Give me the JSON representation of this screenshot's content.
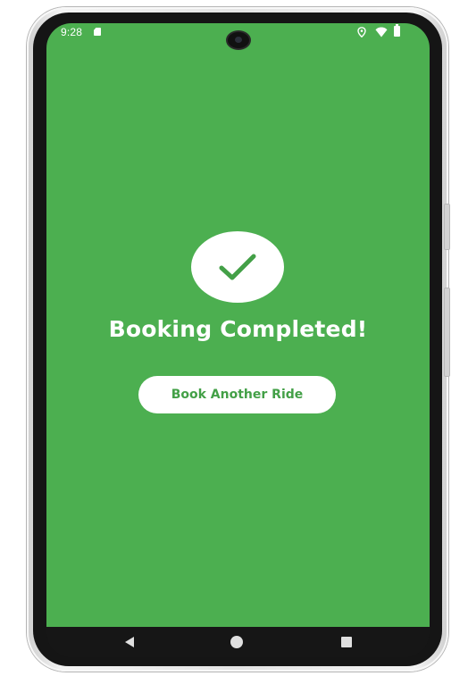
{
  "status_bar": {
    "time": "9:28",
    "icons": [
      "sim-card-icon",
      "location-icon",
      "wifi-icon",
      "battery-icon"
    ]
  },
  "main": {
    "status_icon": "check-icon",
    "title": "Booking Completed!",
    "primary_button_label": "Book Another Ride"
  },
  "nav_bar": {
    "buttons": [
      "back-icon",
      "home-icon",
      "recents-icon"
    ]
  },
  "colors": {
    "background": "#4caf50",
    "accent_text": "#43a047",
    "surface": "#ffffff"
  }
}
